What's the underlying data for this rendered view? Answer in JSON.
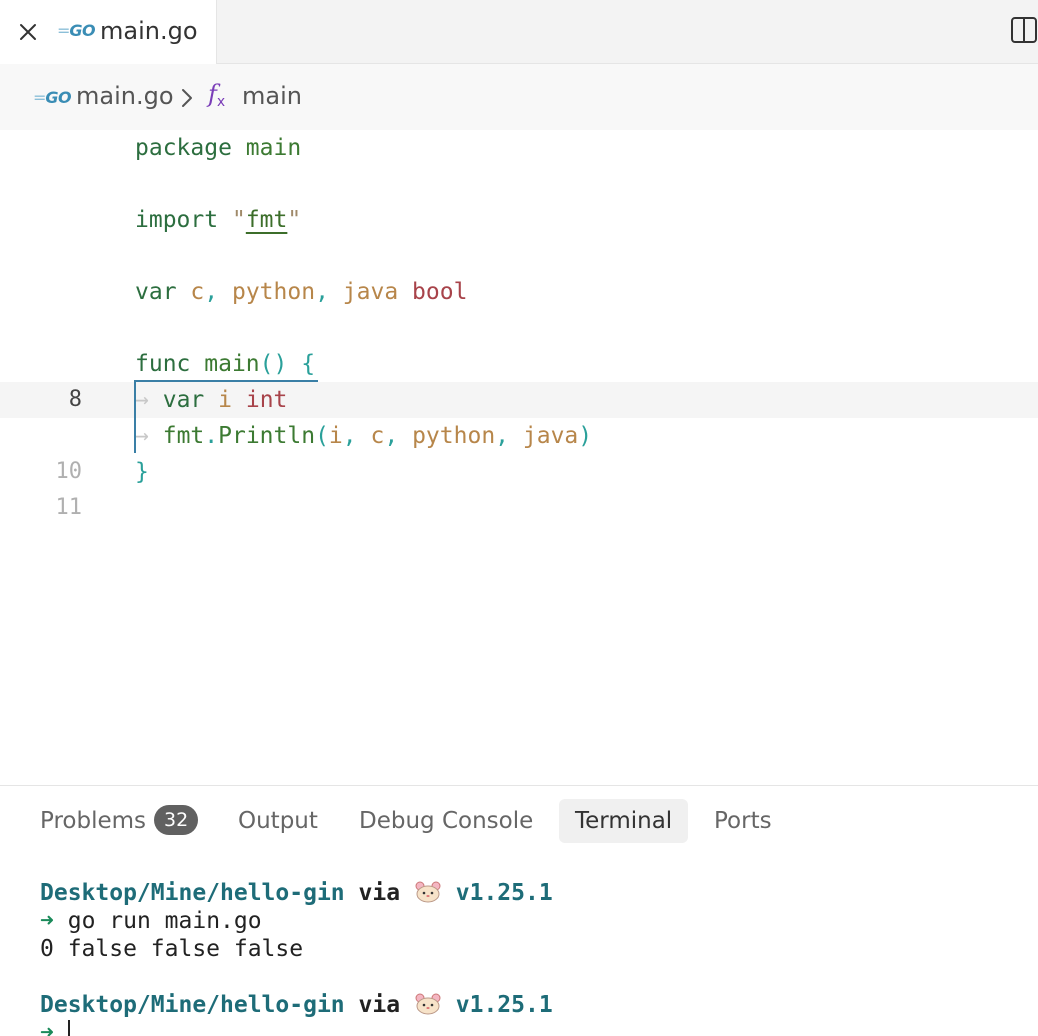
{
  "tab": {
    "go_badge": "GO",
    "file_name": "main.go"
  },
  "breadcrumb": {
    "go_badge": "GO",
    "file": "main.go",
    "fx_label": "f",
    "fx_sub": "x",
    "function": "main"
  },
  "editor": {
    "lines": [
      {
        "num": "",
        "code": "package main"
      },
      {
        "num": "",
        "code": ""
      },
      {
        "num": "",
        "code": "import \"fmt\""
      },
      {
        "num": "",
        "code": ""
      },
      {
        "num": "",
        "code": "var c, python, java bool"
      },
      {
        "num": "",
        "code": ""
      },
      {
        "num": "",
        "code": "func main() {"
      },
      {
        "num": "8",
        "code": "\tvar i int"
      },
      {
        "num": "",
        "code": "\tfmt.Println(i, c, python, java)"
      },
      {
        "num": "10",
        "code": "}"
      },
      {
        "num": "11",
        "code": ""
      }
    ],
    "current_line": "8"
  },
  "panel": {
    "tabs": [
      {
        "label": "Problems",
        "badge": "32"
      },
      {
        "label": "Output"
      },
      {
        "label": "Debug Console"
      },
      {
        "label": "Terminal",
        "active": true
      },
      {
        "label": "Ports"
      }
    ],
    "terminal": {
      "prompt_path": "Desktop/Mine/hello-gin",
      "prompt_via": "via",
      "prompt_version": "v1.25.1",
      "arrow": "➜",
      "command": "go run main.go",
      "output": "0 false false false"
    }
  },
  "colors": {
    "keyword": "#2c6e3f",
    "variable": "#b7864a",
    "type": "#a8434a",
    "punctuation": "#2aa09a",
    "terminal_path": "#1e6c78",
    "badge_bg": "#616161"
  }
}
